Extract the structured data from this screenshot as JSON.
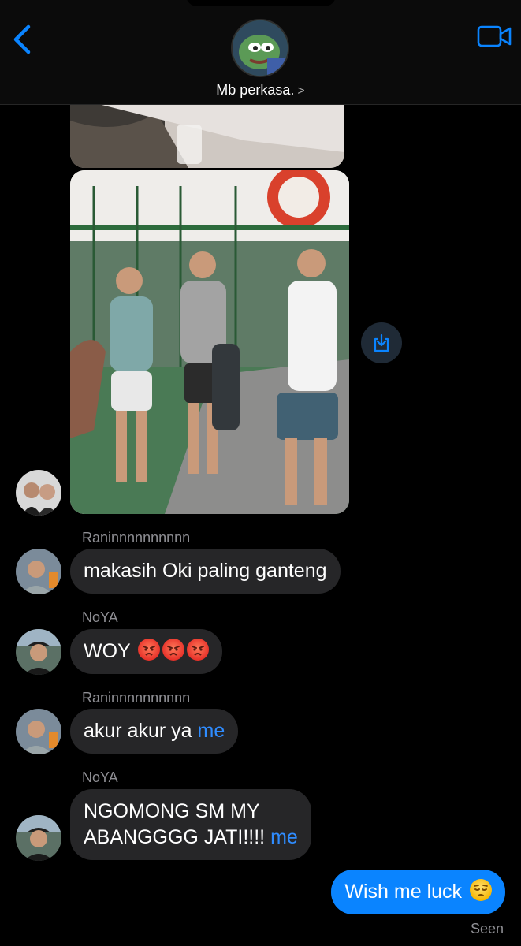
{
  "header": {
    "contact_name": "Mb perkasa.",
    "chevron": ">",
    "back_icon": "chevron-left-icon",
    "video_icon": "video-camera-icon"
  },
  "colors": {
    "accent": "#0a84ff",
    "incoming_bubble": "#262628",
    "background": "#000000",
    "meta_text": "#8e8e93"
  },
  "messages": [
    {
      "sender": "Raninnnnnnnnnn",
      "text": "makasih Oki paling ganteng"
    },
    {
      "sender": "NoYA",
      "text": "WOY",
      "emoji": [
        "angry-face",
        "angry-face",
        "angry-face"
      ]
    },
    {
      "sender": "Raninnnnnnnnnn",
      "text": "akur akur ya",
      "mention": "me"
    },
    {
      "sender": "NoYA",
      "text_line1": "NGOMONG SM MY",
      "text_line2": "ABANGGGG JATI!!!!",
      "mention": "me"
    }
  ],
  "outgoing": {
    "text": "Wish me luck",
    "emoji": "pensive-face",
    "status": "Seen"
  }
}
